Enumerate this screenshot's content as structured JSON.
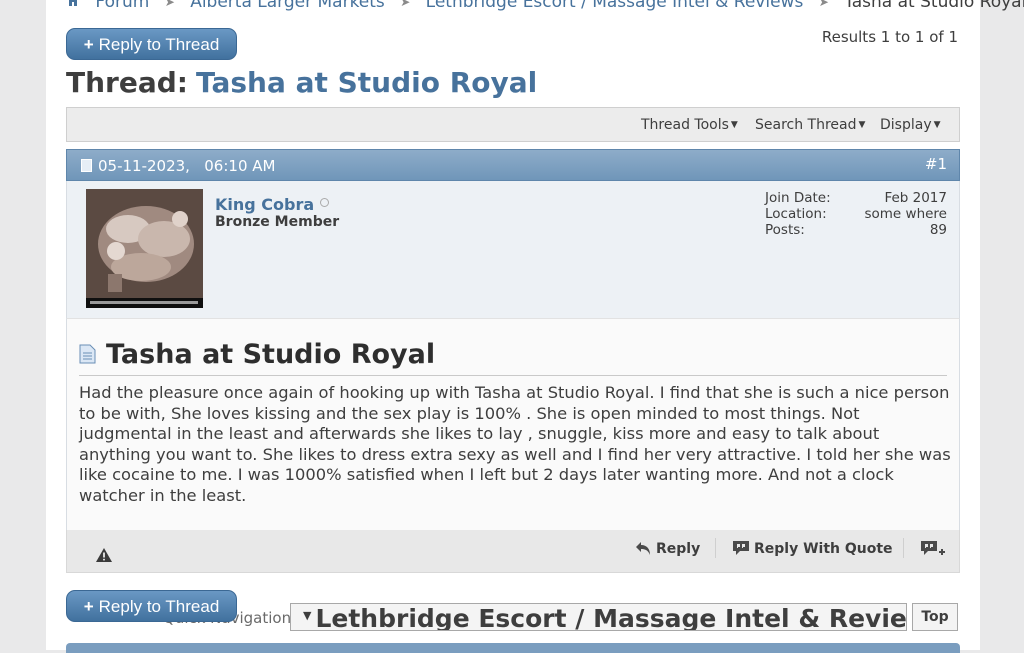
{
  "breadcrumb": {
    "items": [
      "Forum",
      "Alberta Larger Markets",
      "Lethbridge Escort / Massage Intel & Reviews"
    ],
    "current": "Tasha at Studio Royal",
    "home_icon": "home-icon",
    "separator_icon": "arrow-sep-icon"
  },
  "reply_button": {
    "plus": "+",
    "label": "Reply to Thread"
  },
  "results": "Results 1 to 1 of 1",
  "thread": {
    "prefix": "Thread:",
    "title": "Tasha at Studio Royal"
  },
  "toolbar": {
    "thread_tools": "Thread Tools",
    "search_thread": "Search Thread",
    "display": "Display"
  },
  "post": {
    "date": "05-11-2023,",
    "time": "06:10 AM",
    "number": "#1",
    "user": {
      "name": "King Cobra",
      "title": "Bronze Member",
      "join_date_label": "Join Date:",
      "join_date": "Feb 2017",
      "location_label": "Location:",
      "location": "some where",
      "posts_label": "Posts:",
      "posts": "89"
    },
    "title": "Tasha at Studio Royal",
    "body": "Had the pleasure once again of hooking up with Tasha at Studio Royal. I find that she is such a nice person to be with, She loves kissing and the sex play is 100% . She is open minded to most things. Not judgmental in the least and afterwards she likes to lay , snuggle, kiss more and easy to talk about anything you want to. She likes to dress extra sexy as well and I find her very attractive. I told her she was like cocaine to me. I was 1000% satisfied when I left but 2 days later wanting more. And not a clock watcher in the least.",
    "actions": {
      "reply": "Reply",
      "reply_quote": "Reply With Quote"
    }
  },
  "quick_nav": {
    "label": "Quick Navigation",
    "selected": "Lethbridge Escort / Massage Intel & Reviews",
    "top": "Top"
  },
  "colors": {
    "link": "#47729c",
    "header_blue": "#7096b9",
    "button_blue": "#41719e"
  }
}
